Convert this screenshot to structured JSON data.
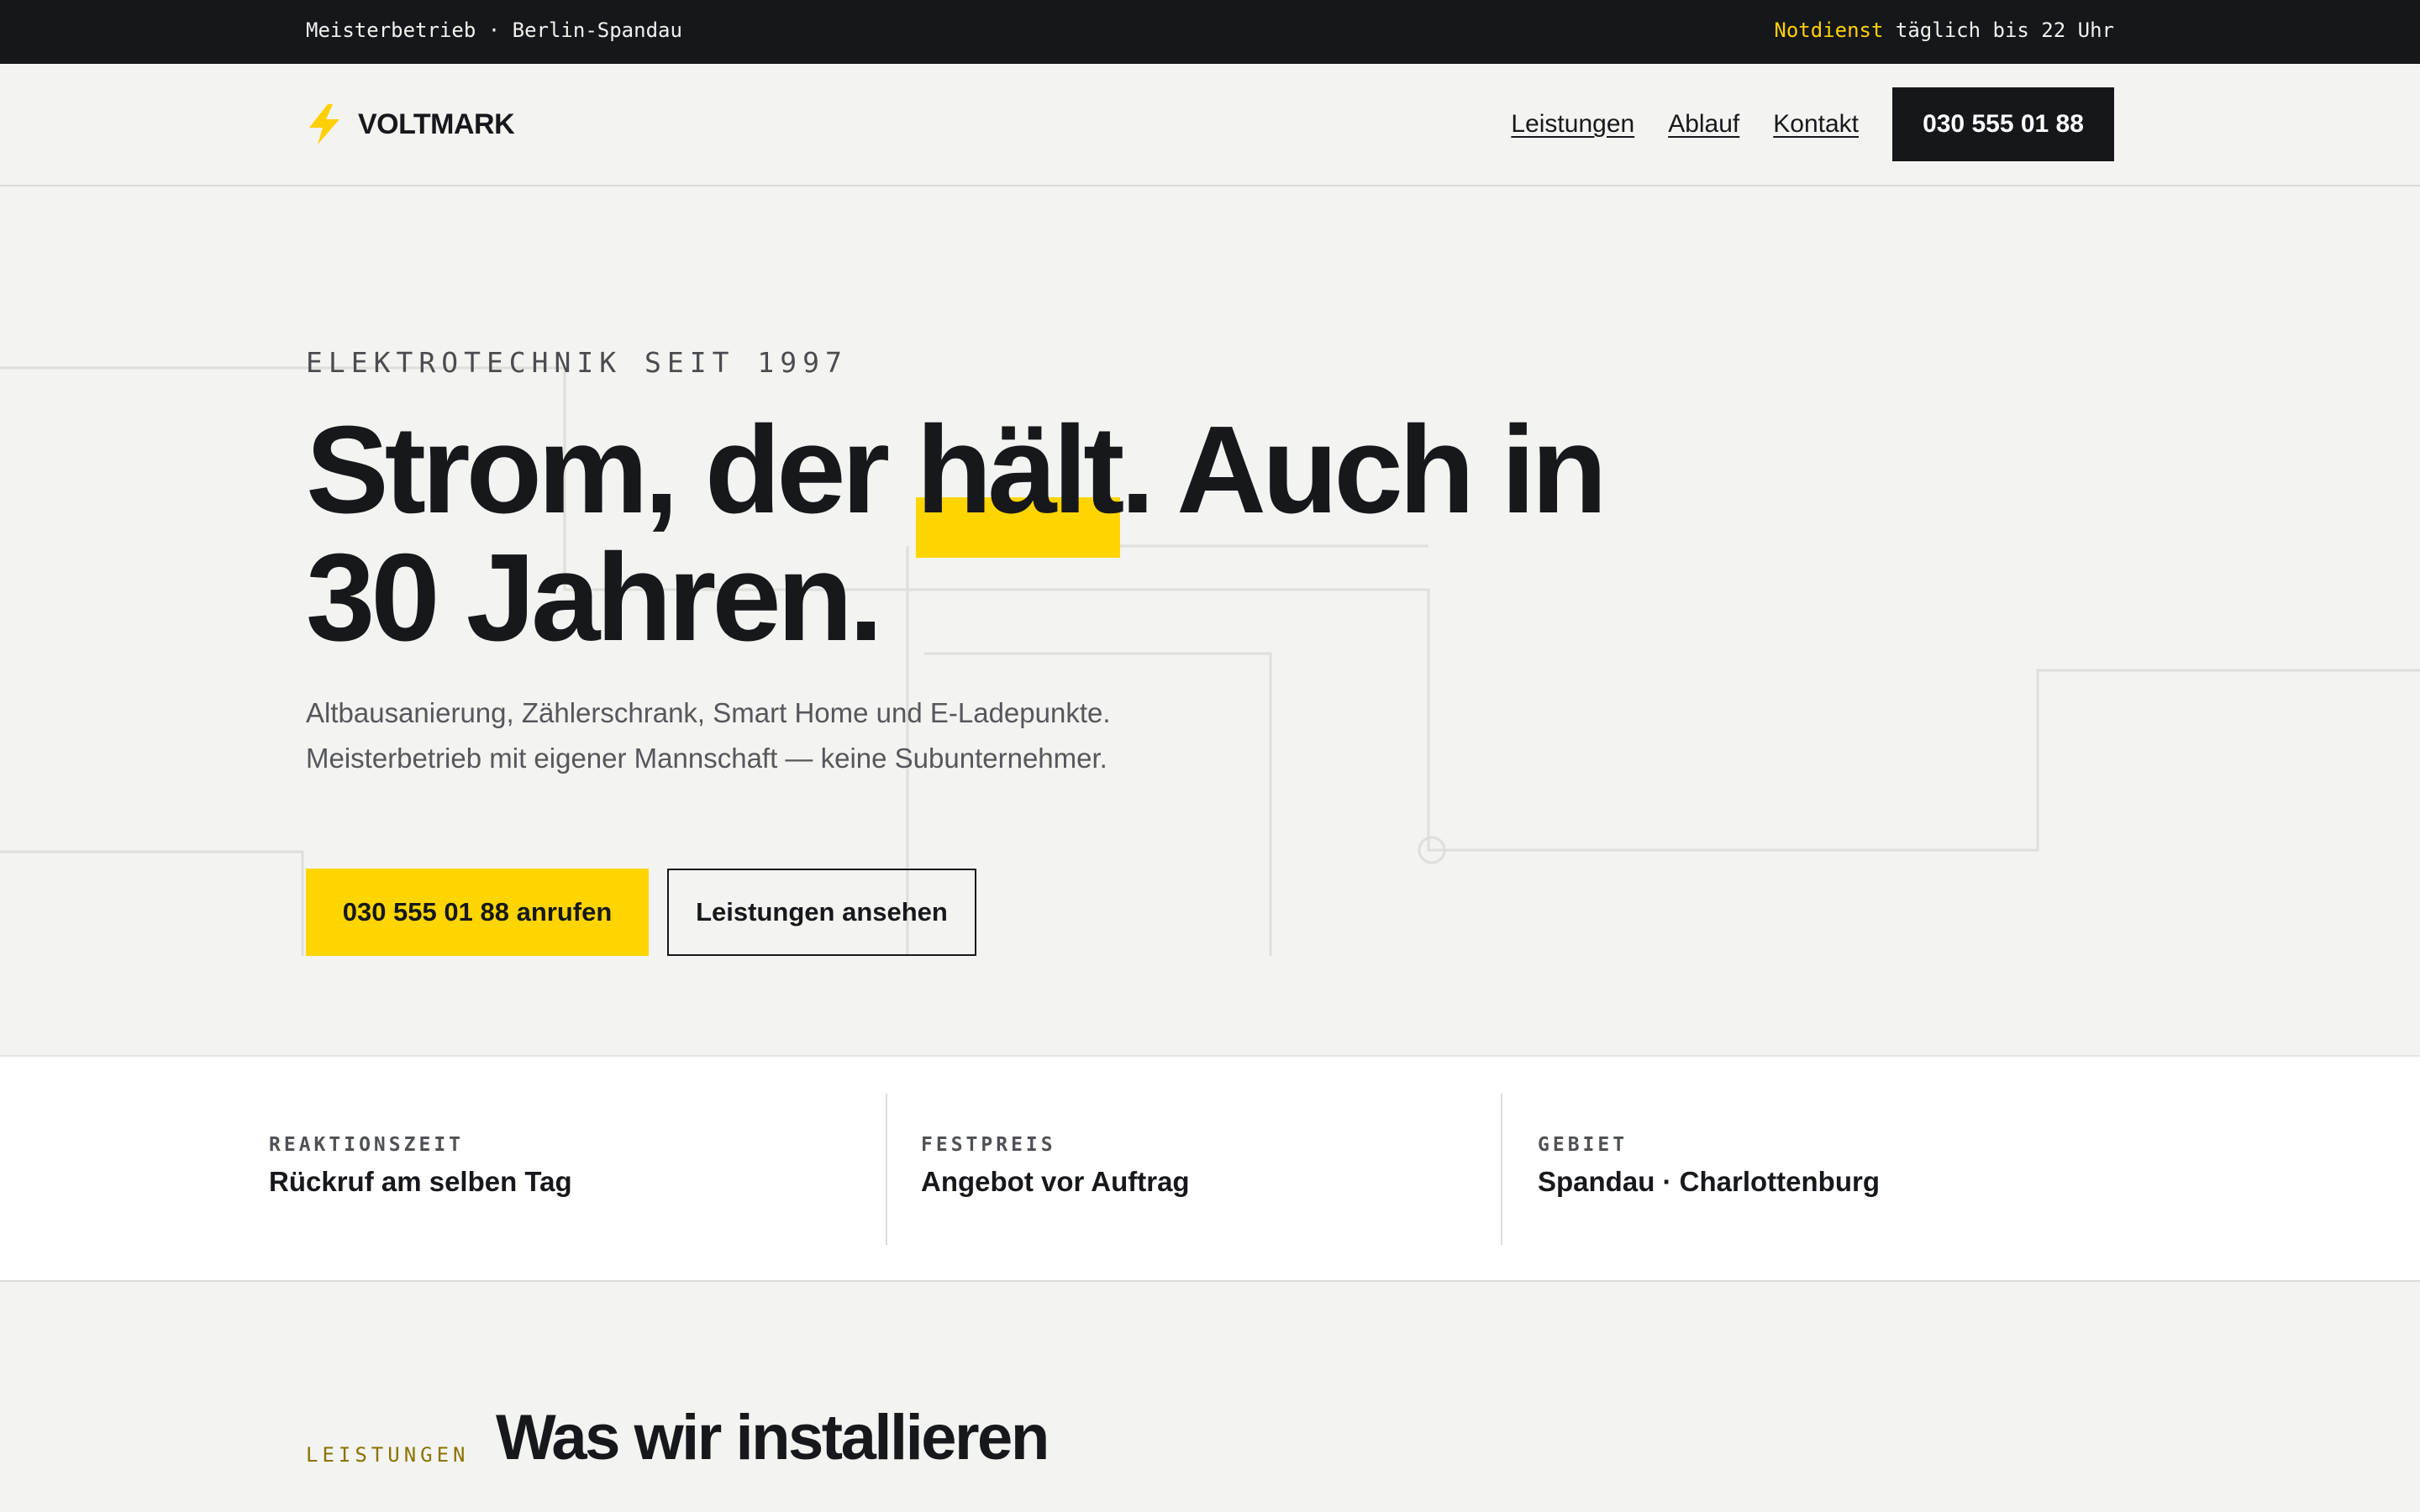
{
  "topbar": {
    "left_text": "Meisterbetrieb · Berlin-Spandau",
    "emergency_label": "Notdienst",
    "emergency_hours": " täglich bis 22 Uhr",
    "accent_color": "#ffd000"
  },
  "header": {
    "logo_text": "VOLTMARK",
    "logo_icon": "lightning-bolt-icon",
    "nav": [
      {
        "label": "Leistungen"
      },
      {
        "label": "Ablauf"
      },
      {
        "label": "Kontakt"
      }
    ],
    "phone_button": "030 555 01 88"
  },
  "hero": {
    "eyebrow": "ELEKTROTECHNIK SEIT 1997",
    "headline_part1": "Strom, der ",
    "headline_highlight": "hält",
    "headline_part2": ". Auch in 30 Jahren.",
    "subtext": "Altbausanierung, Zählerschrank, Smart Home und E-Ladepunkte. Meisterbetrieb mit eigener Mannschaft — keine Subunternehmer.",
    "primary_cta": "030 555 01 88 anrufen",
    "secondary_cta": "Leistungen ansehen",
    "highlight_color": "#ffd500"
  },
  "features": [
    {
      "label": "REAKTIONSZEIT",
      "value": "Rückruf am selben Tag"
    },
    {
      "label": "FESTPREIS",
      "value": "Angebot vor Auftrag"
    },
    {
      "label": "GEBIET",
      "value": "Spandau · Charlottenburg"
    }
  ],
  "services": {
    "kicker": "LEISTUNGEN",
    "title": "Was wir installieren"
  }
}
